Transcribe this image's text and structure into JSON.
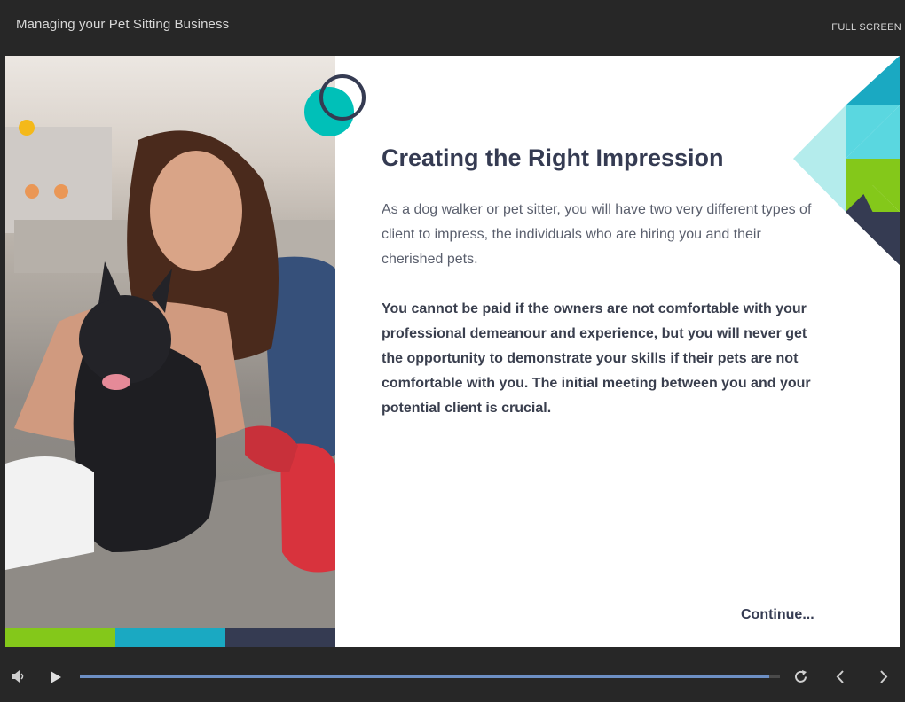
{
  "header": {
    "course_title": "Managing your Pet Sitting Business",
    "fullscreen_label": "FULL SCREEN"
  },
  "slide": {
    "heading": "Creating the Right Impression",
    "intro": "As a dog walker or pet sitter, you will have two very different types of client to impress, the individuals who are hiring you and their cherished pets.",
    "emphasis": "You cannot be paid if the owners are not comfortable with your professional demeanour and experience, but you will never get the opportunity to demonstrate your skills if their pets are not comfortable with you. The initial meeting between you and your potential client is crucial.",
    "continue_label": "Continue...",
    "image_subject": "woman-hugging-french-bulldog-photo"
  },
  "player": {
    "progress_fraction": 0.985,
    "icons": [
      "volume-icon",
      "play-icon",
      "replay-icon",
      "previous-icon",
      "next-icon"
    ]
  },
  "colors": {
    "navy": "#353b52",
    "teal": "#00c0b8",
    "cyan": "#1aa9c2",
    "light_cyan": "#5ad7e0",
    "pale_cyan": "#b4ecec",
    "green": "#84c81a",
    "progress": "#6d8fc4"
  }
}
